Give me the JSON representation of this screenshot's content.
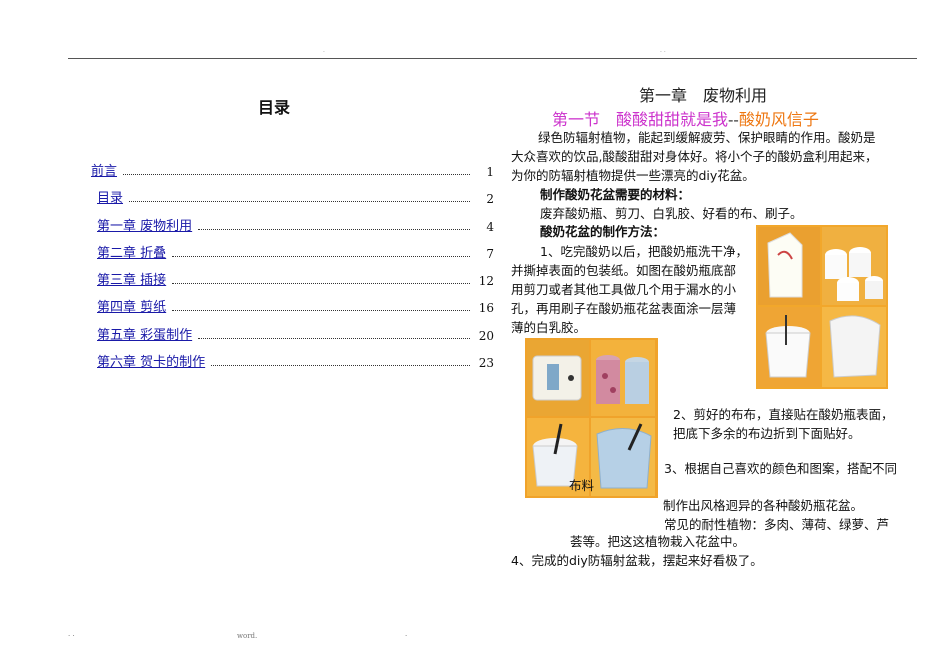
{
  "header": {
    "dot_mid": "·",
    "dot_right": "· ·"
  },
  "toc": {
    "title": "目录",
    "items": [
      {
        "label": "前言",
        "page": "1"
      },
      {
        "label": "目录",
        "page": "2"
      },
      {
        "label": "第一章 废物利用",
        "page": "4"
      },
      {
        "label": "第二章 折叠",
        "page": "7"
      },
      {
        "label": "第三章 插接",
        "page": "12"
      },
      {
        "label": "第四章 剪纸",
        "page": "16"
      },
      {
        "label": "第五章 彩蛋制作",
        "page": "20"
      },
      {
        "label": "第六章 贺卡的制作",
        "page": "23"
      }
    ]
  },
  "chapter": {
    "title": "第一章　废物利用",
    "section_prefix": "第一节　酸酸甜甜就是我",
    "section_sep": "--",
    "section_suffix": "酸奶风信子"
  },
  "body": {
    "intro_lines": [
      "绿色防辐射植物，能起到缓解疲劳、保护眼睛的作用。酸奶是",
      "大众喜欢的饮品,酸酸甜甜对身体好。将小个子的酸奶盒利用起来，",
      "为你的防辐射植物提供一些漂亮的diy花盆。"
    ],
    "materials_title": "制作酸奶花盆需要的材料：",
    "materials": "废弃酸奶瓶、剪刀、白乳胶、好看的布、刷子。",
    "method_title": "酸奶花盆的制作方法：",
    "step1_lines": [
      "1、吃完酸奶以后，把酸奶瓶洗干净，",
      "并撕掉表面的包装纸。如图在酸奶瓶底部",
      "用剪刀或者其他工具做几个用于漏水的小",
      "孔，再用刷子在酸奶瓶花盆表面涂一层薄",
      "薄的白乳胶。"
    ],
    "step2_lines": [
      "2、剪好的布布，直接贴在酸奶瓶表面，",
      "把底下多余的布边折到下面贴好。"
    ],
    "step3_line1": "3、根据自己喜欢的颜色和图案，搭配不同",
    "step3_line2": "制作出风格迥异的各种酸奶瓶花盆。",
    "plants_line1": "常见的耐性植物：多肉、薄荷、绿萝、芦",
    "plants_line2": "荟等。把这这植物栽入花盆中。",
    "step4": "4、完成的diy防辐射盆栽，摆起来好看极了。",
    "photo_caption": "布料"
  },
  "footer": {
    "left": "· ·",
    "center": "word.",
    "right": "·"
  },
  "colors": {
    "toc_link": "#1a1aa8",
    "section_magenta": "#cc33cc",
    "section_orange": "#ee7711",
    "photo_bg": "#f2a72b"
  }
}
